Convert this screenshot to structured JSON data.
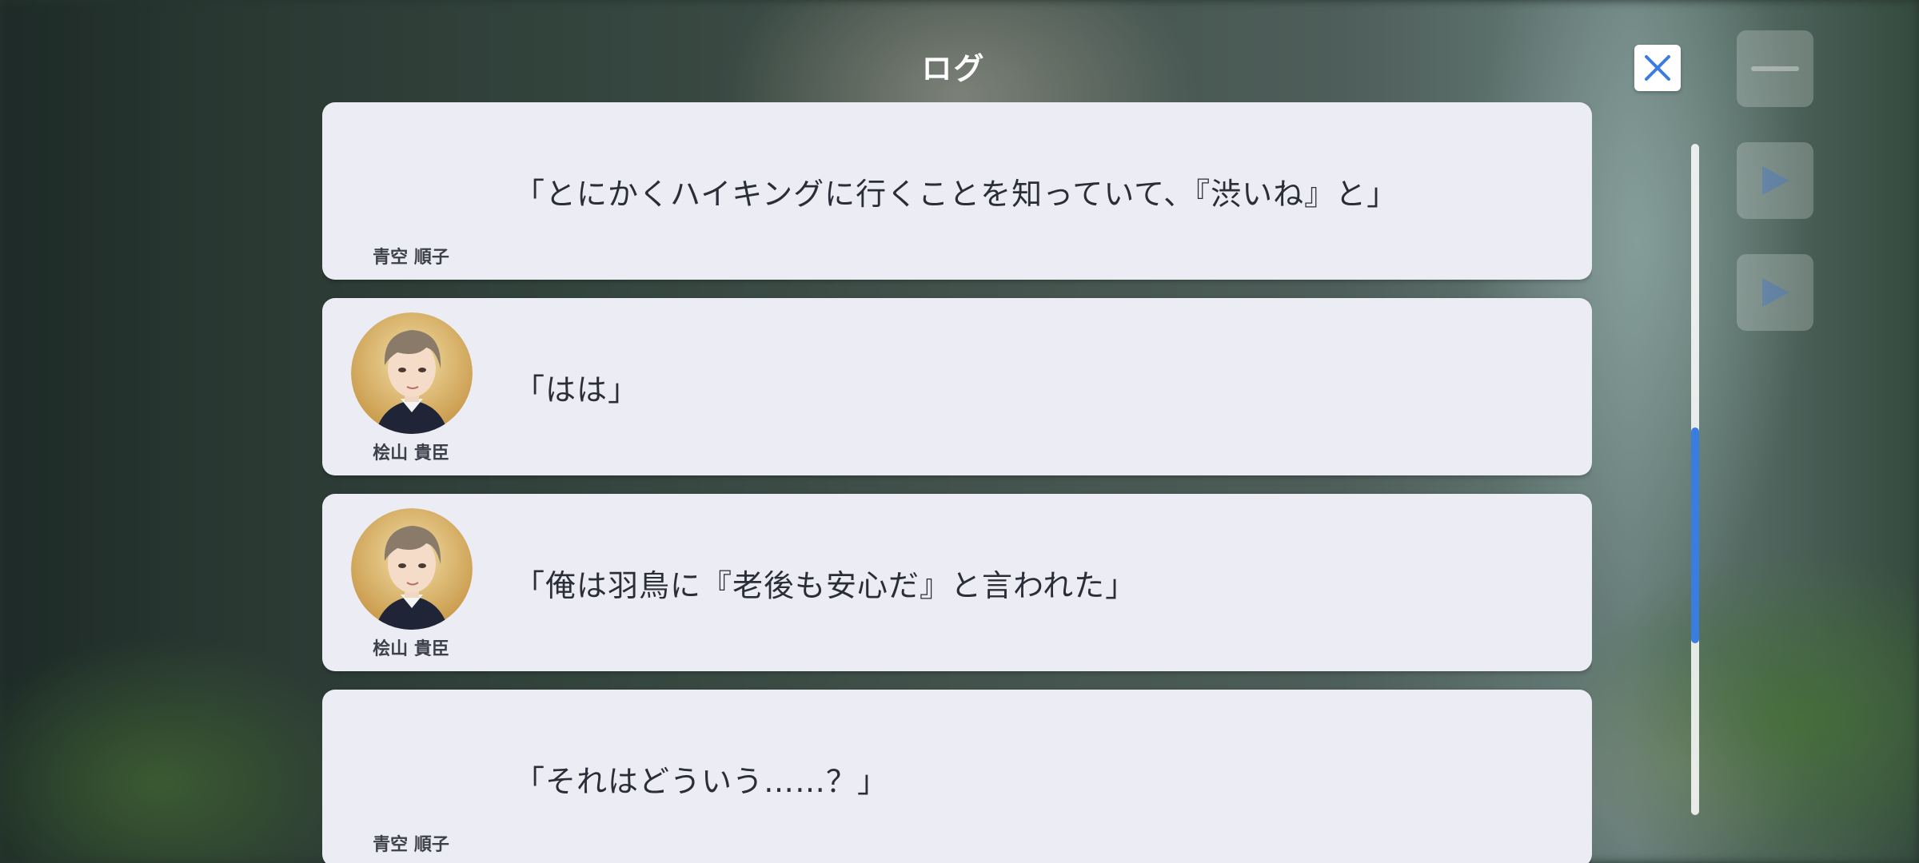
{
  "header": {
    "title": "ログ"
  },
  "log": [
    {
      "speaker": "青空 順子",
      "text": "「とにかくハイキングに行くことを知っていて、『渋いね』と」",
      "avatar": false
    },
    {
      "speaker": "桧山 貴臣",
      "text": "「はは」",
      "avatar": true
    },
    {
      "speaker": "桧山 貴臣",
      "text": "「俺は羽鳥に『老後も安心だ』と言われた」",
      "avatar": true
    },
    {
      "speaker": "青空 順子",
      "text": "「それはどういう……？」",
      "avatar": false
    }
  ],
  "icons": {
    "close": "close-icon",
    "menu": "menu-icon",
    "play": "play-icon",
    "auto": "auto-play-icon"
  },
  "colors": {
    "accent": "#3a7de0",
    "card": "#ecedf4"
  }
}
